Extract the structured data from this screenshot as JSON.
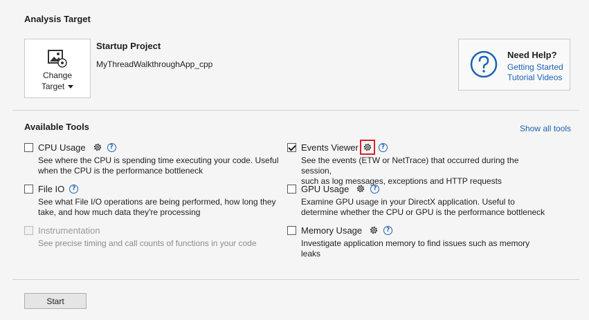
{
  "analysis_target": {
    "title": "Analysis Target",
    "change_target_label": "Change",
    "change_target_label2": "Target",
    "startup_title": "Startup Project",
    "startup_name": "MyThreadWalkthroughApp_cpp"
  },
  "help": {
    "title": "Need Help?",
    "link1": "Getting Started",
    "link2": "Tutorial Videos"
  },
  "tools": {
    "title": "Available Tools",
    "show_all": "Show all tools",
    "cpu": {
      "name": "CPU Usage",
      "desc1": "See where the CPU is spending time executing your code. Useful",
      "desc2": "when the CPU is the performance bottleneck",
      "checked": false
    },
    "fileio": {
      "name": "File IO",
      "desc1": "See what File I/O operations are being performed, how long they",
      "desc2": "take, and how much data they're processing",
      "checked": false
    },
    "instrumentation": {
      "name": "Instrumentation",
      "desc1": "See precise timing and call counts of functions in your code",
      "checked": false
    },
    "events": {
      "name": "Events Viewer",
      "desc1": "See the events (ETW or NetTrace) that occurred during the session,",
      "desc2": "such as log messages, exceptions and HTTP requests",
      "checked": true
    },
    "gpu": {
      "name": "GPU Usage",
      "desc1": "Examine GPU usage in your DirectX application. Useful to",
      "desc2": "determine whether the CPU or GPU is the performance bottleneck",
      "checked": false
    },
    "memory": {
      "name": "Memory Usage",
      "desc1": "Investigate application memory to find issues such as memory",
      "desc2": "leaks",
      "checked": false
    }
  },
  "footer": {
    "start_label": "Start"
  },
  "colors": {
    "link": "#1a62b3",
    "highlight": "#d9222a"
  }
}
